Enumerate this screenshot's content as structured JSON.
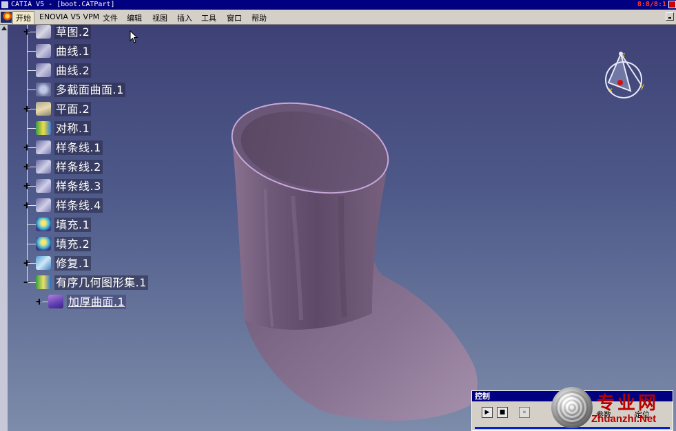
{
  "window": {
    "title": "CATIA V5 - [boot.CATPart]",
    "clock": "8:8/8:1"
  },
  "menubar": {
    "items": [
      "开始",
      "ENOVIA V5 VPM",
      "文件",
      "编辑",
      "视图",
      "插入",
      "工具",
      "窗口",
      "帮助"
    ]
  },
  "tree": {
    "nodes": [
      {
        "label": "草图.2",
        "icon": "sketch-icon",
        "expander": "+"
      },
      {
        "label": "曲线.1",
        "icon": "curve-icon",
        "expander": ""
      },
      {
        "label": "曲线.2",
        "icon": "curve-icon",
        "expander": ""
      },
      {
        "label": "多截面曲面.1",
        "icon": "multi-section-surface-icon",
        "expander": ""
      },
      {
        "label": "平面.2",
        "icon": "plane-icon",
        "expander": "+"
      },
      {
        "label": "对称.1",
        "icon": "symmetry-icon",
        "expander": ""
      },
      {
        "label": "样条线.1",
        "icon": "spline-icon",
        "expander": "+"
      },
      {
        "label": "样条线.2",
        "icon": "spline-icon",
        "expander": "+"
      },
      {
        "label": "样条线.3",
        "icon": "spline-icon",
        "expander": "+"
      },
      {
        "label": "样条线.4",
        "icon": "spline-icon",
        "expander": "+"
      },
      {
        "label": "填充.1",
        "icon": "fill-icon",
        "expander": ""
      },
      {
        "label": "填充.2",
        "icon": "fill-icon",
        "expander": ""
      },
      {
        "label": "修复.1",
        "icon": "healing-icon",
        "expander": "+"
      },
      {
        "label": "有序几何图形集.1",
        "icon": "ordered-geometrical-set-icon",
        "expander": "−"
      },
      {
        "label": "加厚曲面.1",
        "icon": "thick-surface-icon",
        "expander": "+"
      }
    ]
  },
  "compass": {
    "x_label": "x",
    "y_label": "y",
    "z_label": "z"
  },
  "control_panel": {
    "title": "控制",
    "label_left": "参数",
    "label_right": "定位"
  },
  "watermark": {
    "cn": "专业网",
    "url": "Zhuanzhi.Net"
  },
  "colors": {
    "titlebar": "#000080",
    "menubar": "#d4d0c8",
    "model_body": "#6e5a78",
    "watermark": "#b80000"
  }
}
